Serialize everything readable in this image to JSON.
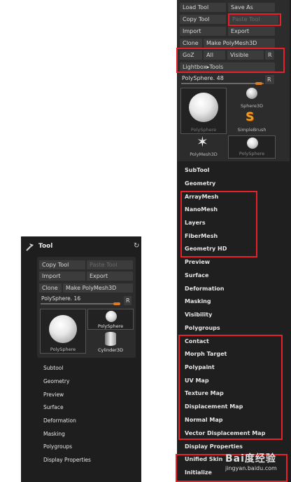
{
  "left_panel": {
    "title": "Tool",
    "buttons": {
      "copy_tool": "Copy Tool",
      "paste_tool": "Paste Tool",
      "import": "Import",
      "export": "Export",
      "clone": "Clone",
      "make_polymesh": "Make PolyMesh3D"
    },
    "slider": {
      "label": "PolySphere. 16",
      "r": "R"
    },
    "thumbs": {
      "main": "PolySphere",
      "sphere": "PolySphere",
      "cyl": "Cylinder3D"
    },
    "menu": [
      "Subtool",
      "Geometry",
      "Preview",
      "Surface",
      "Deformation",
      "Masking",
      "Polygroups",
      "Display Properties"
    ]
  },
  "right_panel": {
    "buttons": {
      "load_tool": "Load Tool",
      "save_as": "Save As",
      "copy_tool": "Copy Tool",
      "paste_tool": "Paste Tool",
      "import": "Import",
      "export": "Export",
      "clone": "Clone",
      "make_polymesh": "Make PolyMesh3D",
      "goz": "GoZ",
      "all": "All",
      "visible": "Visible",
      "r": "R",
      "lightbox": "Lightbox▸Tools"
    },
    "slider": {
      "label": "PolySphere. 48",
      "r": "R"
    },
    "thumbs": {
      "main": "PolySphere",
      "sphere3d": "Sphere3D",
      "simplebrush": "SimpleBrush",
      "polymesh3d": "PolyMesh3D",
      "polysphere": "PolySphere"
    },
    "menu": [
      "SubTool",
      "Geometry",
      "ArrayMesh",
      "NanoMesh",
      "Layers",
      "FiberMesh",
      "Geometry HD",
      "Preview",
      "Surface",
      "Deformation",
      "Masking",
      "Visibility",
      "Polygroups",
      "Contact",
      "Morph Target",
      "Polypaint",
      "UV Map",
      "Texture Map",
      "Displacement Map",
      "Normal Map",
      "Vector Displacement Map",
      "Display Properties",
      "Unified Skin",
      "Initialize"
    ]
  },
  "watermark": {
    "text": "Bai度经验",
    "url": "jingyan.baidu.com"
  }
}
